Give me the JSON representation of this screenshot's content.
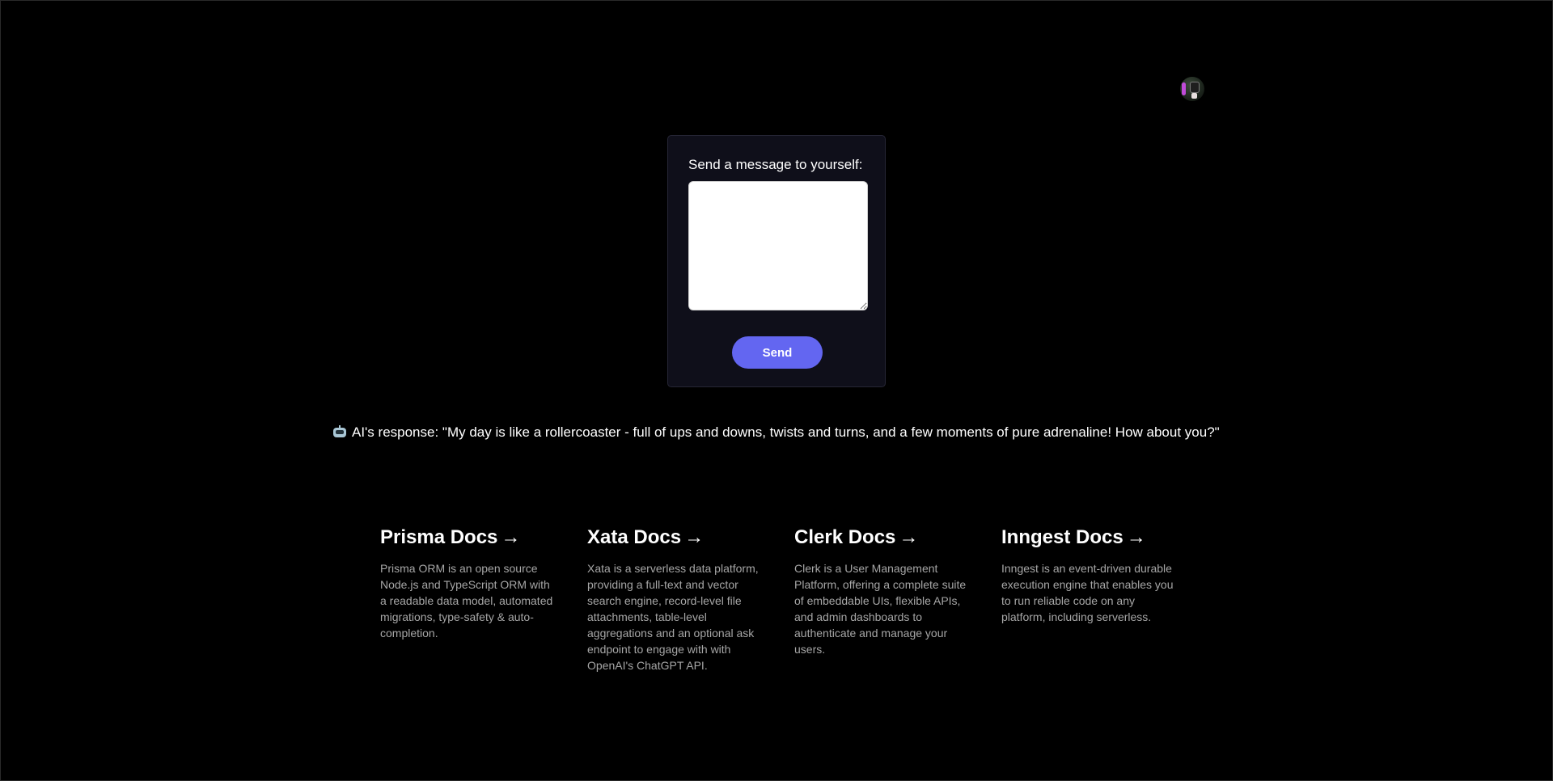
{
  "header": {
    "avatar_icon": "user-avatar-icon"
  },
  "message_form": {
    "label": "Send a message to yourself:",
    "input_value": "",
    "placeholder": "",
    "send_label": "Send",
    "send_button_color": "#6366f1",
    "card_background": "#0f0f1a"
  },
  "ai_response": {
    "icon": "robot-icon",
    "text": "AI's response: \"My day is like a rollercoaster - full of ups and downs, twists and turns, and a few moments of pure adrenaline! How about you?\""
  },
  "docs": [
    {
      "title": "Prisma Docs",
      "arrow": "->",
      "description": "Prisma ORM is an open source Node.js and TypeScript ORM with a readable data model, automated migrations, type-safety & auto-completion."
    },
    {
      "title": "Xata Docs",
      "arrow": "->",
      "description": "Xata is a serverless data platform, providing a full-text and vector search engine, record-level file attachments, table-level aggregations and an optional ask endpoint to engage with with OpenAI's ChatGPT API."
    },
    {
      "title": "Clerk Docs",
      "arrow": "->",
      "description": "Clerk is a User Management Platform, offering a complete suite of embeddable UIs, flexible APIs, and admin dashboards to authenticate and manage your users."
    },
    {
      "title": "Inngest Docs",
      "arrow": "->",
      "description": "Inngest is an event-driven durable execution engine that enables you to run reliable code on any platform, including serverless."
    }
  ]
}
